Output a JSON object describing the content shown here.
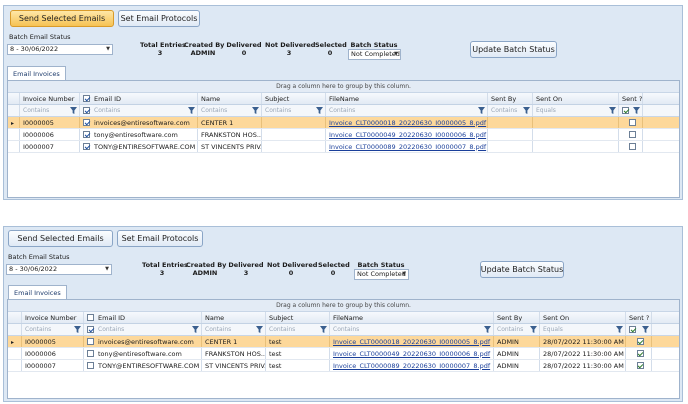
{
  "colors": {
    "accent_orange": "#f6c253",
    "selected_row": "#fdd89a",
    "link": "#1a3f9a",
    "panel_bg": "#dde8f4"
  },
  "panel1": {
    "buttons": {
      "send": "Send Selected Emails",
      "protocols": "Set Email Protocols",
      "update": "Update Batch Status"
    },
    "batch_label": "Batch Email Status",
    "batch_value": "8 - 30/06/2022",
    "stats": [
      {
        "label": "Total Entries",
        "value": "3"
      },
      {
        "label": "Created By",
        "value": "ADMIN"
      },
      {
        "label": "Delivered",
        "value": "0"
      },
      {
        "label": "Not Delivered",
        "value": "3"
      },
      {
        "label": "Selected",
        "value": "0"
      }
    ],
    "batch_status": {
      "label": "Batch Status",
      "value": "Not Completed"
    },
    "tab": "Email Invoices",
    "drag_hint": "Drag a column here to group by this column.",
    "columns": [
      "Invoice Number",
      "Email ID",
      "Name",
      "Subject",
      "FileName",
      "Sent By",
      "Sent On",
      "Sent ?"
    ],
    "filters": {
      "contains": "Contains",
      "equals": "Equals"
    },
    "rows": [
      {
        "invoice": "I0000005",
        "email": "invoices@entiresoftware.com",
        "email_checked": true,
        "name": "CENTER 1",
        "subject": "",
        "file": "Invoice_CLT0000018_20220630_I0000005_8.pdf",
        "sent_by": "",
        "sent_on": "",
        "sent": false
      },
      {
        "invoice": "I0000006",
        "email": "tony@entiresoftware.com",
        "email_checked": true,
        "name": "FRANKSTON  HOS...",
        "subject": "",
        "file": "Invoice_CLT0000049_20220630_I0000006_8.pdf",
        "sent_by": "",
        "sent_on": "",
        "sent": false
      },
      {
        "invoice": "I0000007",
        "email": "TONY@ENTIRESOFTWARE.COM",
        "email_checked": true,
        "name": "ST VINCENTS PRIV...",
        "subject": "",
        "file": "Invoice_CLT0000089_20220630_I0000007_8.pdf",
        "sent_by": "",
        "sent_on": "",
        "sent": false
      }
    ]
  },
  "panel2": {
    "buttons": {
      "send": "Send Selected Emails",
      "protocols": "Set Email Protocols",
      "update": "Update Batch Status"
    },
    "batch_label": "Batch Email Status",
    "batch_value": "8 - 30/06/2022",
    "stats": [
      {
        "label": "Total Entries",
        "value": "3"
      },
      {
        "label": "Created By",
        "value": "ADMIN"
      },
      {
        "label": "Delivered",
        "value": "3"
      },
      {
        "label": "Not Delivered",
        "value": "0"
      },
      {
        "label": "Selected",
        "value": "0"
      }
    ],
    "batch_status": {
      "label": "Batch Status",
      "value": "Not Completed"
    },
    "tab": "Email Invoices",
    "drag_hint": "Drag a column here to group by this column.",
    "columns": [
      "Invoice Number",
      "Email ID",
      "Name",
      "Subject",
      "FileName",
      "Sent By",
      "Sent On",
      "Sent ?"
    ],
    "filters": {
      "contains": "Contains",
      "equals": "Equals"
    },
    "rows": [
      {
        "invoice": "I0000005",
        "email": "invoices@entiresoftware.com",
        "email_checked": false,
        "name": "CENTER 1",
        "subject": "test",
        "file": "Invoice_CLT0000018_20220630_I0000005_8.pdf",
        "sent_by": "ADMIN",
        "sent_on": "28/07/2022 11:30:00 AM",
        "sent": true
      },
      {
        "invoice": "I0000006",
        "email": "tony@entiresoftware.com",
        "email_checked": false,
        "name": "FRANKSTON  HOS...",
        "subject": "test",
        "file": "Invoice_CLT0000049_20220630_I0000006_8.pdf",
        "sent_by": "ADMIN",
        "sent_on": "28/07/2022 11:30:00 AM",
        "sent": true
      },
      {
        "invoice": "I0000007",
        "email": "TONY@ENTIRESOFTWARE.COM",
        "email_checked": false,
        "name": "ST VINCENTS PRIV...",
        "subject": "test",
        "file": "Invoice_CLT0000089_20220630_I0000007_8.pdf",
        "sent_by": "ADMIN",
        "sent_on": "28/07/2022 11:30:00 AM",
        "sent": true
      }
    ]
  }
}
